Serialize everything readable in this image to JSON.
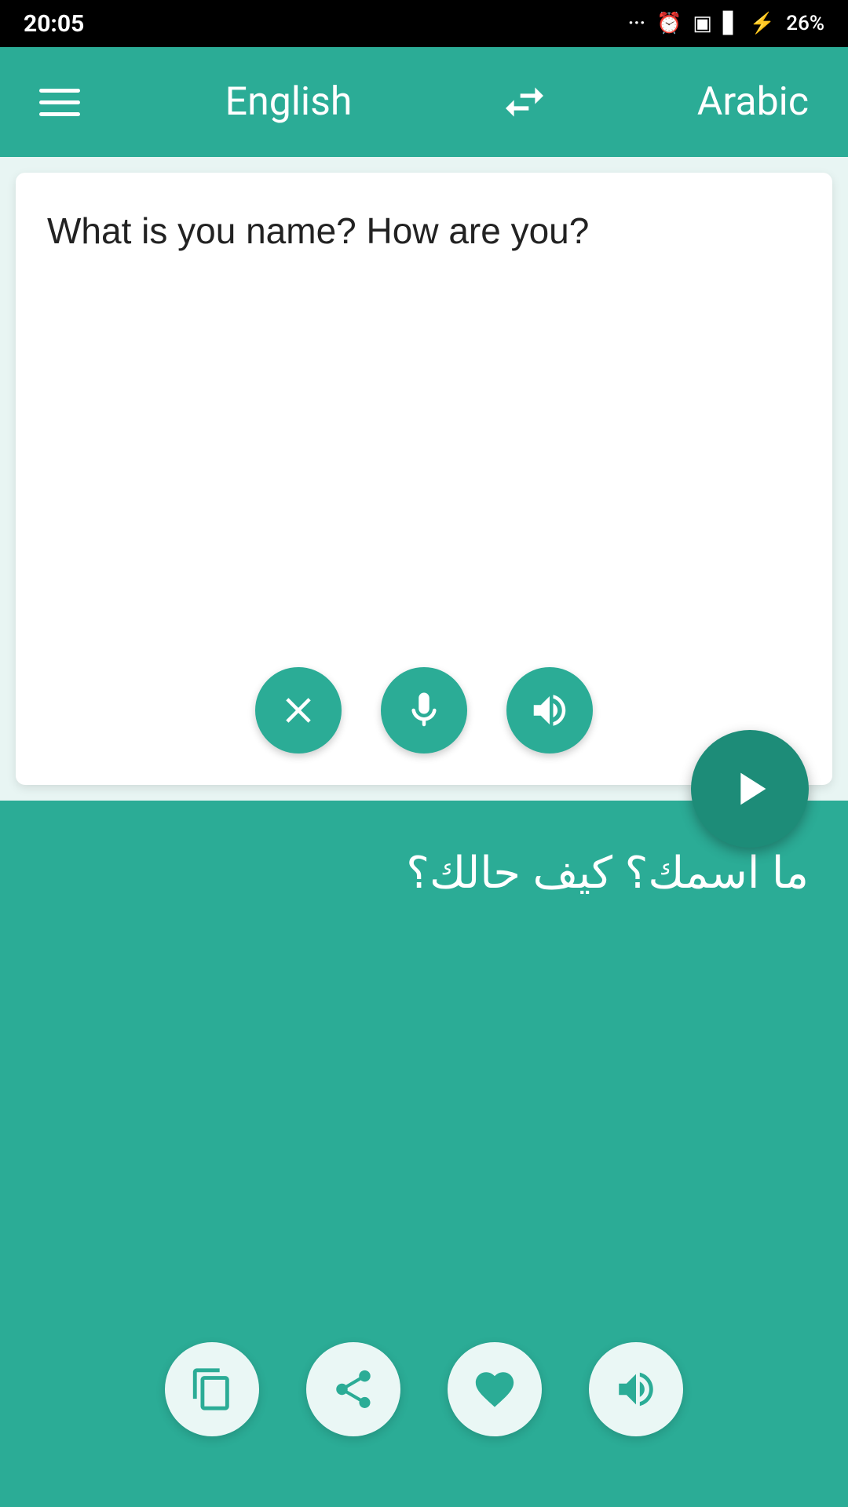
{
  "statusBar": {
    "time": "20:05",
    "battery": "26%"
  },
  "toolbar": {
    "menuLabel": "menu",
    "sourceLang": "English",
    "swapLabel": "swap languages",
    "targetLang": "Arabic"
  },
  "inputSection": {
    "text": "What is you name? How are you?",
    "clearLabel": "clear",
    "micLabel": "microphone",
    "speakLabel": "speak"
  },
  "translateButton": {
    "label": "translate"
  },
  "outputSection": {
    "text": "ما اسمك؟ كيف حالك؟",
    "copyLabel": "copy",
    "shareLabel": "share",
    "favoriteLabel": "favorite",
    "speakLabel": "speak"
  }
}
